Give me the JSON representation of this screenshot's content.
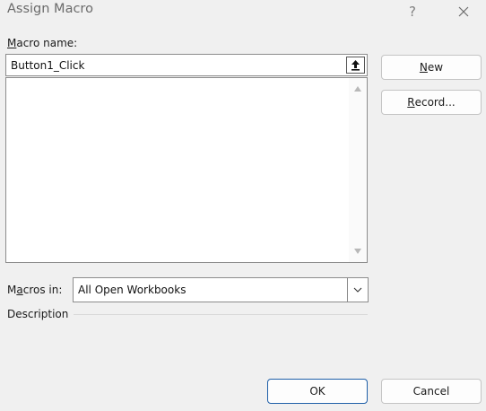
{
  "dialog": {
    "title": "Assign Macro",
    "help_label": "?",
    "close_icon": "close-icon"
  },
  "macro_name": {
    "label_accel": "M",
    "label_rest": "acro name:",
    "value": "Button1_Click",
    "upload_icon": "upload-icon"
  },
  "macro_list": {
    "items": [],
    "scroll_up_icon": "triangle-up-icon",
    "scroll_down_icon": "triangle-down-icon"
  },
  "buttons": {
    "new_accel": "N",
    "new_rest": "ew",
    "record_accel": "R",
    "record_rest": "ecord...",
    "ok": "OK",
    "cancel": "Cancel"
  },
  "macros_in": {
    "label_pre": "M",
    "label_accel": "a",
    "label_rest": "cros in:",
    "selected": "All Open Workbooks",
    "dropdown_icon": "chevron-down-icon"
  },
  "description": {
    "label": "Description"
  }
}
